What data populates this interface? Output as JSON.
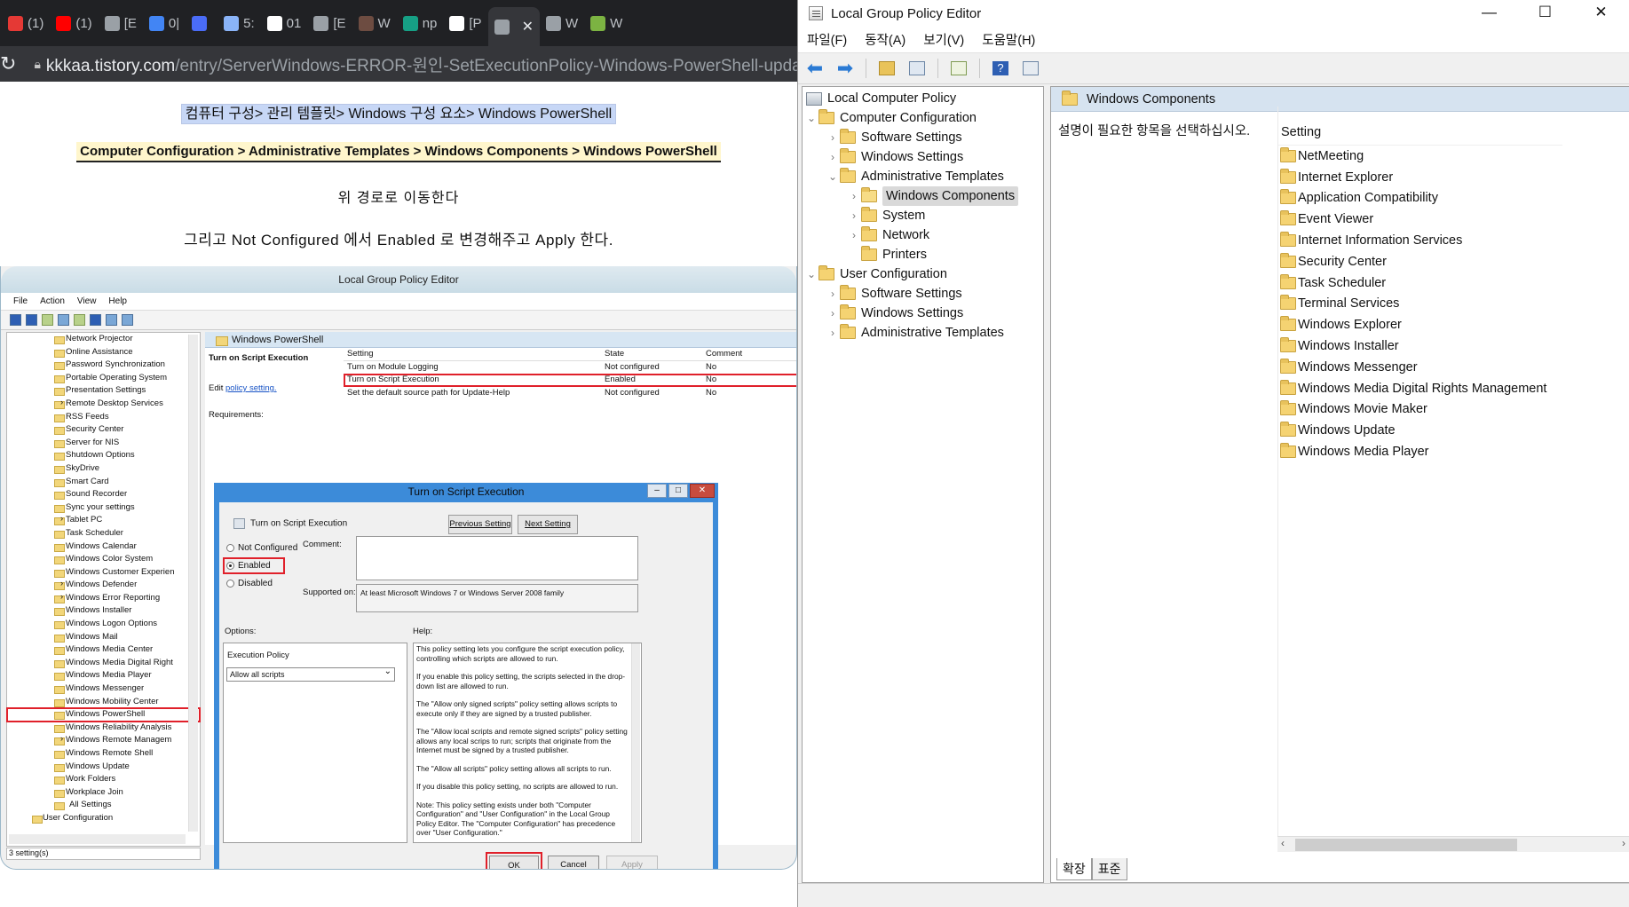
{
  "browser": {
    "tabs": [
      {
        "label": "(1)",
        "color": "#e53935"
      },
      {
        "label": "(1)",
        "color": "#ff0000"
      },
      {
        "label": "[E",
        "color": "#9aa0a6"
      },
      {
        "label": "0|",
        "color": "#4285f4"
      },
      {
        "label": "",
        "color": "#4a6cf7"
      },
      {
        "label": "5:",
        "color": "#8ab4f8"
      },
      {
        "label": "01",
        "color": "#ffffff"
      },
      {
        "label": "[E",
        "color": "#9aa0a6"
      },
      {
        "label": "W",
        "color": "#6d4c41"
      },
      {
        "label": "np",
        "color": "#16a085"
      },
      {
        "label": "[P",
        "color": "#ffffff"
      },
      {
        "label": "",
        "color": "#9aa0a6"
      },
      {
        "label": "W",
        "color": "#9aa0a6"
      },
      {
        "label": "W",
        "color": "#7cb342"
      }
    ],
    "url_domain": "kkkaa.tistory.com",
    "url_path": "/entry/ServerWindows-ERROR-원인-SetExecutionPolicy-Windows-PowerShell-updated"
  },
  "article": {
    "path_ko": "컴퓨터 구성> 관리 템플릿> Windows 구성 요소> Windows PowerShell",
    "path_en": "Computer Configuration > Administrative Templates > Windows Components > Windows PowerShell",
    "line1": "위 경로로 이동한다",
    "line2": "그리고 Not Configured 에서 Enabled 로 변경해주고 Apply 한다."
  },
  "screenshot": {
    "title": "Local Group Policy Editor",
    "menu": [
      "File",
      "Action",
      "View",
      "Help"
    ],
    "tree_items": [
      {
        "label": "Network Projector",
        "expand": false
      },
      {
        "label": "Online Assistance",
        "expand": false
      },
      {
        "label": "Password Synchronization",
        "expand": false
      },
      {
        "label": "Portable Operating System",
        "expand": false
      },
      {
        "label": "Presentation Settings",
        "expand": false
      },
      {
        "label": "Remote Desktop Services",
        "expand": true
      },
      {
        "label": "RSS Feeds",
        "expand": false
      },
      {
        "label": "Security Center",
        "expand": false
      },
      {
        "label": "Server for NIS",
        "expand": false
      },
      {
        "label": "Shutdown Options",
        "expand": false
      },
      {
        "label": "SkyDrive",
        "expand": false
      },
      {
        "label": "Smart Card",
        "expand": false
      },
      {
        "label": "Sound Recorder",
        "expand": false
      },
      {
        "label": "Sync your settings",
        "expand": false
      },
      {
        "label": "Tablet PC",
        "expand": true
      },
      {
        "label": "Task Scheduler",
        "expand": false
      },
      {
        "label": "Windows Calendar",
        "expand": false
      },
      {
        "label": "Windows Color System",
        "expand": false
      },
      {
        "label": "Windows Customer Experien",
        "expand": false
      },
      {
        "label": "Windows Defender",
        "expand": true
      },
      {
        "label": "Windows Error Reporting",
        "expand": true
      },
      {
        "label": "Windows Installer",
        "expand": false
      },
      {
        "label": "Windows Logon Options",
        "expand": false
      },
      {
        "label": "Windows Mail",
        "expand": false
      },
      {
        "label": "Windows Media Center",
        "expand": false
      },
      {
        "label": "Windows Media Digital Right",
        "expand": false
      },
      {
        "label": "Windows Media Player",
        "expand": false
      },
      {
        "label": "Windows Messenger",
        "expand": false
      },
      {
        "label": "Windows Mobility Center",
        "expand": false
      },
      {
        "label": "Windows PowerShell",
        "expand": false,
        "selected": true
      },
      {
        "label": "Windows Reliability Analysis",
        "expand": false
      },
      {
        "label": "Windows Remote Managem",
        "expand": true
      },
      {
        "label": "Windows Remote Shell",
        "expand": false
      },
      {
        "label": "Windows Update",
        "expand": false
      },
      {
        "label": "Work Folders",
        "expand": false
      },
      {
        "label": "Workplace Join",
        "expand": false
      }
    ],
    "all_settings": "All Settings",
    "user_configuration": "User Configuration",
    "status": "3 setting(s)",
    "pane_header": "Windows PowerShell",
    "pane_desc_title": "Turn on Script Execution",
    "pane_edit_prefix": "Edit ",
    "pane_edit_link": "policy setting.",
    "pane_requirements": "Requirements:",
    "grid_headers": {
      "setting": "Setting",
      "state": "State",
      "comment": "Comment"
    },
    "grid_rows": [
      {
        "setting": "Turn on Module Logging",
        "state": "Not configured",
        "comment": "No"
      },
      {
        "setting": "Turn on Script Execution",
        "state": "Enabled",
        "comment": "No",
        "selected": true
      },
      {
        "setting": "Set the default source path for Update-Help",
        "state": "Not configured",
        "comment": "No"
      }
    ],
    "dialog": {
      "title": "Turn on Script Execution",
      "subtitle": "Turn on Script Execution",
      "prev_setting": "Previous Setting",
      "next_setting": "Next Setting",
      "not_configured": "Not Configured",
      "enabled": "Enabled",
      "disabled": "Disabled",
      "comment_label": "Comment:",
      "supported_label": "Supported on:",
      "supported_value": "At least Microsoft Windows 7 or Windows Server 2008 family",
      "options_label": "Options:",
      "help_label": "Help:",
      "exec_policy_label": "Execution Policy",
      "exec_policy_value": "Allow all scripts",
      "help_paragraphs": [
        "This policy setting lets you configure the script execution policy, controlling which scripts are allowed to run.",
        "If you enable this policy setting, the scripts selected in the drop-down list are allowed to run.",
        "The \"Allow only signed scripts\" policy setting allows scripts to execute only if they are signed by a trusted publisher.",
        "The \"Allow local scripts and remote signed scripts\" policy setting allows any local scrips to run; scripts that originate from the Internet must be signed by a trusted publisher.",
        "The \"Allow all scripts\" policy setting allows all scripts to run.",
        "If you disable this policy setting, no scripts are allowed to run.",
        "Note: This policy setting exists under both \"Computer Configuration\" and \"User Configuration\" in the Local Group Policy Editor. The \"Computer Configuration\" has precedence over \"User Configuration.\""
      ],
      "ok": "OK",
      "cancel": "Cancel",
      "apply": "Apply"
    }
  },
  "gpe": {
    "title": "Local Group Policy Editor",
    "menu": [
      "파일(F)",
      "동작(A)",
      "보기(V)",
      "도움말(H)"
    ],
    "tree": {
      "root": "Local Computer Policy",
      "computer_configuration": "Computer Configuration",
      "cc_software_settings": "Software Settings",
      "cc_windows_settings": "Windows Settings",
      "cc_admin_templates": "Administrative Templates",
      "windows_components": "Windows Components",
      "system": "System",
      "network": "Network",
      "printers": "Printers",
      "user_configuration": "User Configuration",
      "uc_software_settings": "Software Settings",
      "uc_windows_settings": "Windows Settings",
      "uc_admin_templates": "Administrative Templates"
    },
    "header": "Windows Components",
    "description": "설명이 필요한 항목을 선택하십시오.",
    "column_header": "Setting",
    "items": [
      "NetMeeting",
      "Internet Explorer",
      "Application Compatibility",
      "Event Viewer",
      "Internet Information Services",
      "Security Center",
      "Task Scheduler",
      "Terminal Services",
      "Windows Explorer",
      "Windows Installer",
      "Windows Messenger",
      "Windows Media Digital Rights Management",
      "Windows Movie Maker",
      "Windows Update",
      "Windows Media Player"
    ],
    "tabs": {
      "extended": "확장",
      "standard": "표준"
    }
  }
}
